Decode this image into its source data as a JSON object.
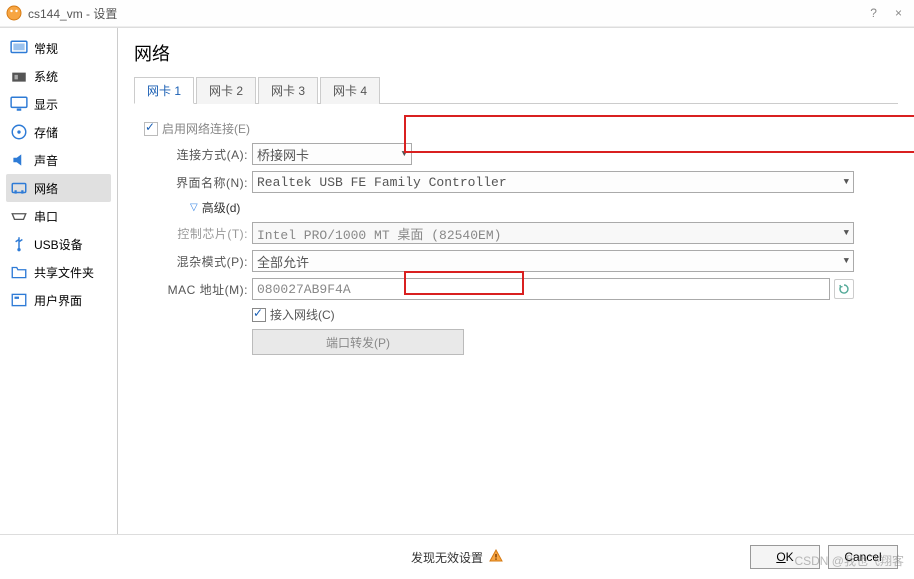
{
  "window": {
    "title": "cs144_vm - 设置",
    "help": "?",
    "close": "×"
  },
  "sidebar": {
    "items": [
      {
        "label": "常规",
        "icon": "general",
        "color": "#2e7bd6"
      },
      {
        "label": "系统",
        "icon": "system",
        "color": "#333"
      },
      {
        "label": "显示",
        "icon": "display",
        "color": "#2e7bd6"
      },
      {
        "label": "存储",
        "icon": "storage",
        "color": "#2e7bd6"
      },
      {
        "label": "声音",
        "icon": "audio",
        "color": "#2e7bd6"
      },
      {
        "label": "网络",
        "icon": "network",
        "color": "#2e7bd6",
        "selected": true
      },
      {
        "label": "串口",
        "icon": "serial",
        "color": "#333"
      },
      {
        "label": "USB设备",
        "icon": "usb",
        "color": "#2e7bd6"
      },
      {
        "label": "共享文件夹",
        "icon": "shared",
        "color": "#2e7bd6"
      },
      {
        "label": "用户界面",
        "icon": "ui",
        "color": "#2e7bd6"
      }
    ]
  },
  "page": {
    "title": "网络",
    "tabs": [
      "网卡 1",
      "网卡 2",
      "网卡 3",
      "网卡 4"
    ],
    "active_tab": 0,
    "enable_label": "启用网络连接(E)",
    "enable_checked": true,
    "attached_label": "连接方式(A):",
    "attached_value": "桥接网卡",
    "name_label": "界面名称(N):",
    "name_value": "Realtek USB FE Family Controller",
    "advanced_label": "高级(d)",
    "chip_label": "控制芯片(T):",
    "chip_value": "Intel PRO/1000 MT 桌面 (82540EM)",
    "promisc_label": "混杂模式(P):",
    "promisc_value": "全部允许",
    "mac_label": "MAC 地址(M):",
    "mac_value": "080027AB9F4A",
    "cable_label": "接入网线(C)",
    "cable_checked": true,
    "port_button": "端口转发(P)"
  },
  "footer": {
    "message": "发现无效设置",
    "ok": "OK",
    "cancel": "Cancel"
  },
  "watermark": "CSDN @我也飞翔客"
}
